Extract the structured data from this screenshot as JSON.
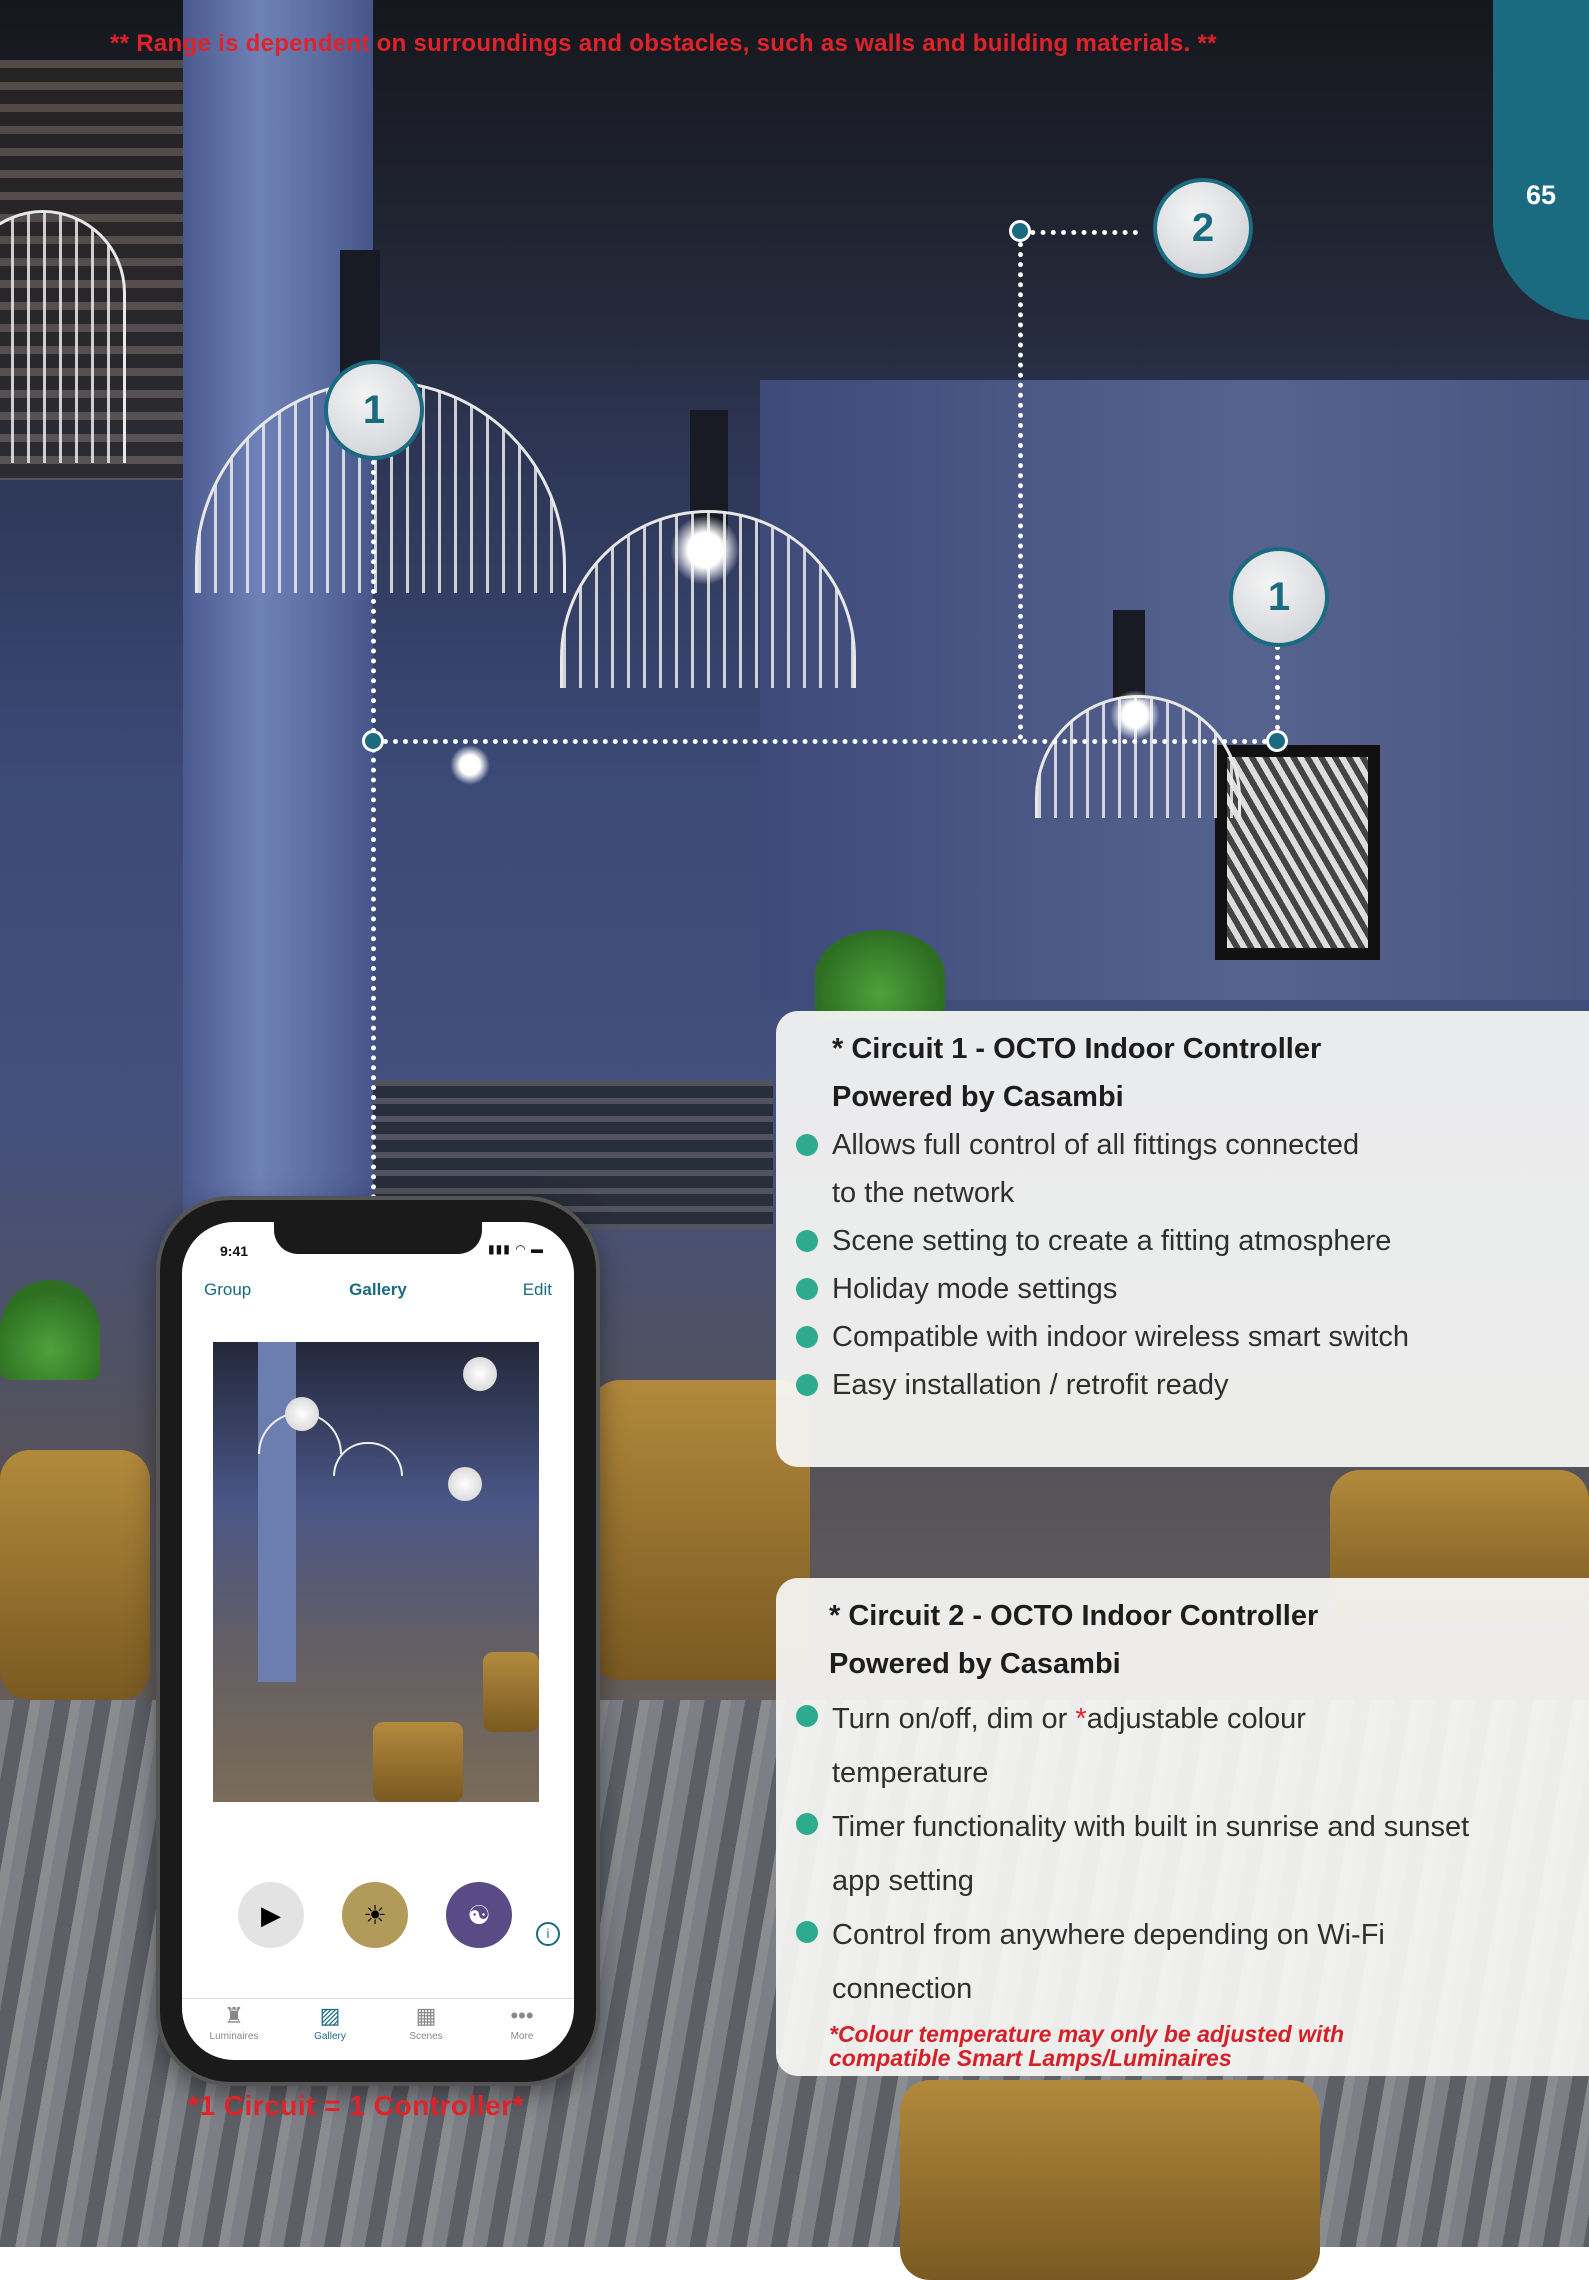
{
  "header": {
    "range_note": "** Range is dependent on surroundings and obstacles, such as walls and building materials. **",
    "page_number": "65"
  },
  "markers": [
    {
      "label": "1"
    },
    {
      "label": "2"
    },
    {
      "label": "1"
    }
  ],
  "circuit1": {
    "title_line1": "* Circuit 1 - OCTO Indoor Controller",
    "title_line2": "Powered by Casambi",
    "bullets": [
      "Allows full control of all fittings connected",
      "to the network",
      "Scene setting to create a fitting atmosphere",
      "Holiday mode settings",
      "Compatible with indoor wireless smart switch",
      "Easy installation / retrofit ready"
    ]
  },
  "circuit2": {
    "title_line1": "* Circuit 2 - OCTO Indoor Controller",
    "title_line2": "Powered by Casambi",
    "bullet1_pre": "Turn on/off, dim or ",
    "bullet1_star": "*",
    "bullet1_post": "adjustable colour",
    "bullet1_cont": "temperature",
    "bullet2": "Timer functionality with built in sunrise and sunset",
    "bullet2_cont": "app setting",
    "bullet3": "Control from anywhere depending on Wi-Fi",
    "bullet3_cont": "connection",
    "footnote_line1": "*Colour temperature may only be adjusted with",
    "footnote_line2": "compatible Smart Lamps/Luminaires"
  },
  "phone": {
    "time": "9:41",
    "status_icons": "▮▮▮ ◠ ▬",
    "nav_left": "Group",
    "nav_title": "Gallery",
    "nav_right": "Edit",
    "actions": [
      {
        "icon": "scenes-play-icon",
        "glyph": "▶",
        "color": "#e3e3e3"
      },
      {
        "icon": "brightness-icon",
        "glyph": "☀",
        "color": "#b29a5a"
      },
      {
        "icon": "yin-yang-icon",
        "glyph": "☯",
        "color": "#5a4a86"
      }
    ],
    "info_glyph": "i",
    "tabs": [
      {
        "label": "Luminaires",
        "glyph": "♜",
        "active": false
      },
      {
        "label": "Gallery",
        "glyph": "▨",
        "active": true
      },
      {
        "label": "Scenes",
        "glyph": "▦",
        "active": false
      },
      {
        "label": "More",
        "glyph": "•••",
        "active": false
      }
    ]
  },
  "phone_caption": "*1 Circuit = 1 Controller*",
  "colors": {
    "accent_teal": "#1a6a80",
    "bullet_green": "#2eaa8e",
    "alert_red": "#e0232a"
  }
}
